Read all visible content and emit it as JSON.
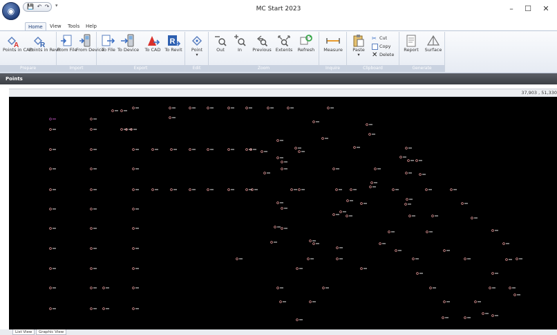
{
  "window": {
    "title": "MC Start 2023",
    "minimize": "–",
    "maximize": "☐",
    "close": "✕"
  },
  "qat": {
    "dropdown": "▾"
  },
  "tabs": [
    {
      "label": "Home",
      "active": true
    },
    {
      "label": "View",
      "active": false
    },
    {
      "label": "Tools",
      "active": false
    },
    {
      "label": "Help",
      "active": false
    }
  ],
  "ribbon": {
    "groups": {
      "prepare": "Prepare",
      "import": "Import",
      "export": "Export",
      "edit": "Edit",
      "zoom": "Zoom",
      "inquire": "Inquire",
      "clipboard": "Clipboard",
      "generate": "Generate"
    },
    "buttons": {
      "points_in_cad": "Points in CAD",
      "points_in_revit": "Points in Revit",
      "from_file": "From File",
      "from_device": "From Device",
      "to_file": "To File",
      "to_device": "To Device",
      "to_cad": "To CAD",
      "to_revit": "To Revit",
      "point": "Point",
      "out": "Out",
      "in": "In",
      "previous": "Previous",
      "extents": "Extents",
      "refresh": "Refresh",
      "measure": "Measure",
      "paste": "Paste",
      "cut": "Cut",
      "copy": "Copy",
      "delete": "Delete",
      "report": "Report",
      "surface": "Surface"
    }
  },
  "panel": {
    "title": "Points"
  },
  "coordinates": {
    "readout": "37,903 , 51,330"
  },
  "bottom_tabs": [
    "List View",
    "Graphic View"
  ],
  "colors": {
    "canvas": "#000000",
    "point_symbol": "#f2a0a0",
    "point_label": "#d8d8d8",
    "first_point": "#b04fb0",
    "ribbon_accent": "#3b6fc4"
  }
}
